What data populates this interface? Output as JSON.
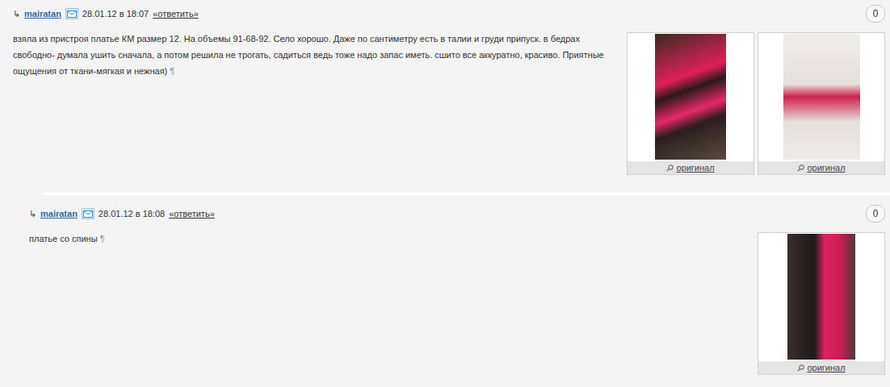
{
  "comments": [
    {
      "arrow": "↳",
      "author": "mairatan",
      "date": "28.01.12 в 18:07",
      "reply": "«ответить»",
      "votes": "0",
      "is_reply": false,
      "text": "взяла из пристроя платье КМ размер 12. На объемы 91-68-92. Село хорошо. Даже по сантиметру есть в талии и груди припуск. в бедрах свободно- думала ушить сначала, а потом решила не трогать, садиться ведь тоже надо запас иметь. сшито все аккуратно, красиво. Приятные ощущения от ткани-мягкая и нежная)",
      "pilcrow": "¶",
      "photos": [
        {
          "caption": "оригинал"
        },
        {
          "caption": "оригинал"
        }
      ]
    },
    {
      "arrow": "↳",
      "author": "mairatan",
      "date": "28.01.12 в 18:08",
      "reply": "«ответить»",
      "votes": "0",
      "is_reply": true,
      "text": "платье со спины",
      "pilcrow": "¶",
      "photos": [
        {
          "caption": "оригинал"
        }
      ]
    }
  ]
}
